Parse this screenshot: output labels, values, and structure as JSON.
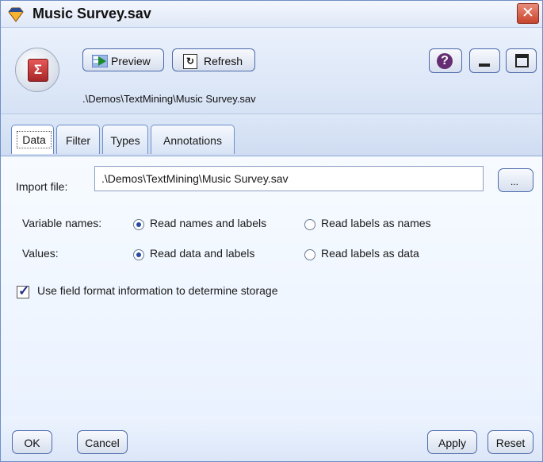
{
  "window": {
    "title": "Music Survey.sav",
    "close_glyph": "✕"
  },
  "toolbar": {
    "node_icon_label": "Σ",
    "preview_label": "Preview",
    "refresh_label": "Refresh",
    "file_path": ".\\Demos\\TextMining\\Music Survey.sav",
    "help_label": "?"
  },
  "tabs": [
    {
      "label": "Data"
    },
    {
      "label": "Filter"
    },
    {
      "label": "Types"
    },
    {
      "label": "Annotations"
    }
  ],
  "data_tab": {
    "import_label": "Import file:",
    "import_value": ".\\Demos\\TextMining\\Music Survey.sav",
    "browse_label": "...",
    "variable_names_label": "Variable names:",
    "variable_options": [
      {
        "label": "Read names and labels",
        "selected": true
      },
      {
        "label": "Read labels as names",
        "selected": false
      }
    ],
    "values_label": "Values:",
    "value_options": [
      {
        "label": "Read data and labels",
        "selected": true
      },
      {
        "label": "Read labels as data",
        "selected": false
      }
    ],
    "use_field_format_label": "Use field format information to determine storage",
    "use_field_format_checked": true
  },
  "footer": {
    "ok_label": "OK",
    "cancel_label": "Cancel",
    "apply_label": "Apply",
    "reset_label": "Reset"
  },
  "colors": {
    "accent": "#4c68ab",
    "close_button": "#c7452d",
    "node_icon": "#a72528"
  },
  "icons": {
    "title": "diamond-icon",
    "preview": "preview-icon",
    "refresh": "refresh-icon",
    "help": "help-icon",
    "minimize": "minimize-icon",
    "maximize": "maximize-icon"
  }
}
